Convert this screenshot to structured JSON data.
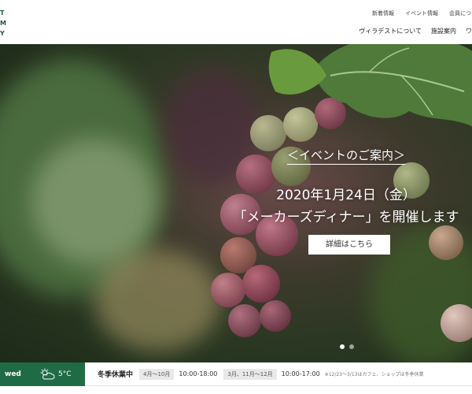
{
  "logo": {
    "lines": [
      "T",
      "M",
      "Y"
    ]
  },
  "top_links": [
    "新着情報",
    "イベント情報",
    "会員につい"
  ],
  "main_nav": [
    "ヴィラデストについて",
    "施設案内",
    "ワイ"
  ],
  "hero": {
    "heading": "＜イベントのご案内＞",
    "date": "2020年1月24日（金）",
    "title": "「メーカーズディナー」を開催します",
    "button_label": "詳細はこちら",
    "slide_count": 2,
    "active_slide": 1
  },
  "infobar": {
    "weekday": "wed",
    "weather_icon": "partly-cloudy-icon",
    "temperature": "5°C",
    "status": "冬季休業中",
    "hours": [
      {
        "period": "4月〜10月",
        "time": "10:00-18:00"
      },
      {
        "period": "3月、11月〜12月",
        "time": "10:00-17:00"
      }
    ],
    "note": "※12/23〜3/13はカフェ、ショップは冬季休業"
  },
  "colors": {
    "brand_green": "#1f6b45",
    "logo_green": "#1f5c3e"
  }
}
